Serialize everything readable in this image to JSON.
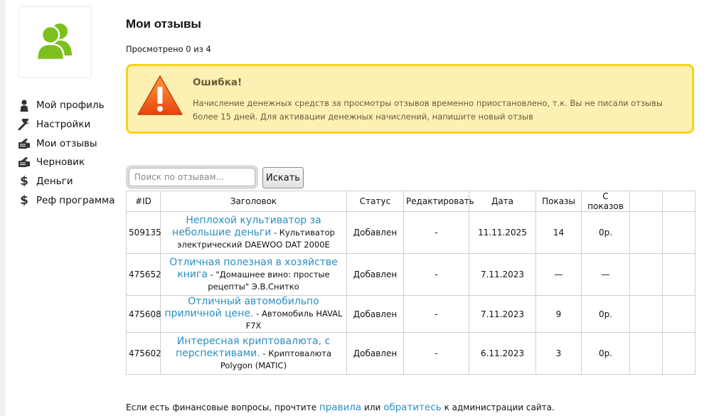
{
  "sidebar": {
    "items": [
      {
        "label": "Мой профиль",
        "icon": "person-icon"
      },
      {
        "label": "Настройки",
        "icon": "wrench-icon"
      },
      {
        "label": "Мои отзывы",
        "icon": "hand-writing-icon"
      },
      {
        "label": "Черновик",
        "icon": "hand-writing-icon"
      },
      {
        "label": "Деньги",
        "icon": "dollar-icon"
      },
      {
        "label": "Реф программа",
        "icon": "dollar-icon"
      }
    ],
    "dollar_glyph": "$"
  },
  "header": {
    "title": "Мои отзывы",
    "viewed": "Просмотрено 0 из 4"
  },
  "alert": {
    "title": "Ошибка!",
    "text": "Начисление денежных средств за просмотры отзывов временно приостановлено, т.к. Вы не писали отзывы более 15 дней. Для активации денежных начислений, напишите новый отзыв"
  },
  "search": {
    "placeholder": "Поиск по отзывам...",
    "button": "Искать"
  },
  "table": {
    "headers": [
      "#ID",
      "Заголовок",
      "Статус",
      "Редактировать",
      "Дата",
      "Показы",
      "С показов",
      "",
      ""
    ],
    "rows": [
      {
        "id": "509135",
        "link": "Неплохой культиватор за небольшие деньги",
        "object": " - Культиватор электрический DAEWOO DAT 2000E",
        "status": "Добавлен",
        "edit": "-",
        "date": "11.11.2025",
        "views": "14",
        "earned": "0р."
      },
      {
        "id": "475652",
        "link": "Отличная полезная в хозяйстве книга",
        "object": " - \"Домашнее вино: простые рецепты\" Э.В.Снитко",
        "status": "Добавлен",
        "edit": "-",
        "date": "7.11.2023",
        "views": "—",
        "earned": "—"
      },
      {
        "id": "475608",
        "link": "Отличный автомобильпо приличной цене.",
        "object": " - Автомобиль HAVAL F7X",
        "status": "Добавлен",
        "edit": "-",
        "date": "7.11.2023",
        "views": "9",
        "earned": "0р."
      },
      {
        "id": "475602",
        "link": "Интересная криптовалюта, с перспективами.",
        "object": " - Криптовалюта Polygon (MATIC)",
        "status": "Добавлен",
        "edit": "-",
        "date": "6.11.2023",
        "views": "3",
        "earned": "0р."
      }
    ]
  },
  "footer": {
    "prefix": "Если есть финансовые вопросы, прочтите ",
    "rules_link": "правила",
    "middle": " или ",
    "contact_link": "обратитесь",
    "suffix": " к администрации сайта."
  },
  "colors": {
    "link": "#2a8fc4",
    "status": "#6f9e2f",
    "alert_bg": "#fdf0b3",
    "alert_border": "#f7d21b",
    "avatar": "#7cc01e"
  }
}
